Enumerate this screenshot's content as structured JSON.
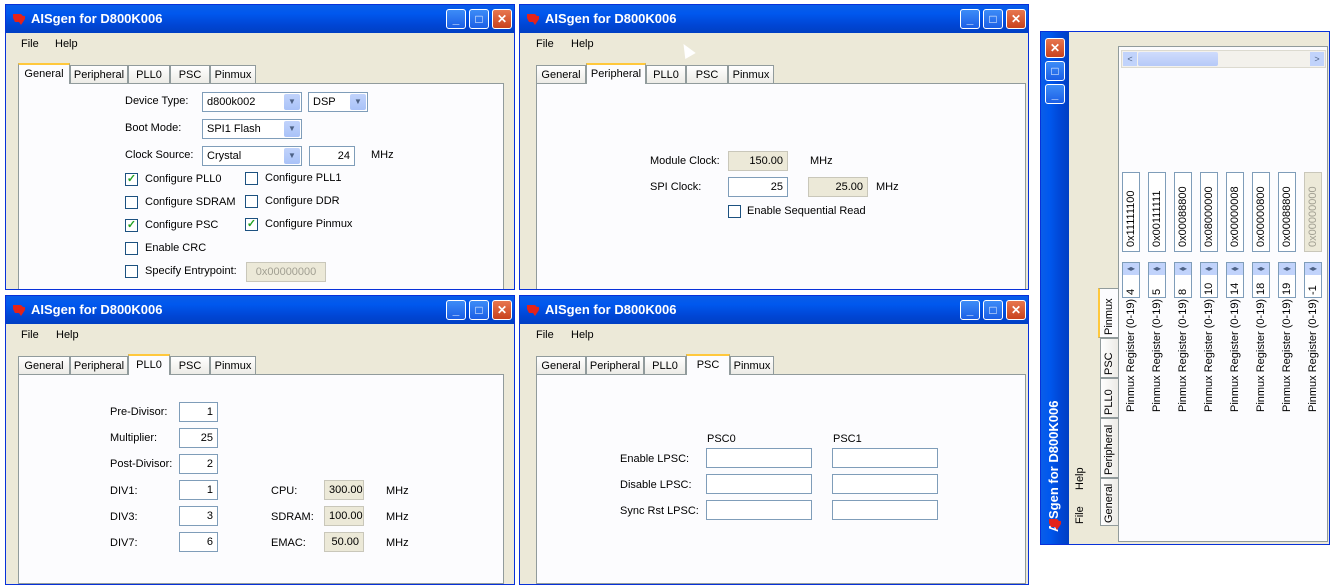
{
  "app_title": "AISgen for D800K006",
  "menu": {
    "file": "File",
    "help": "Help"
  },
  "tabs": [
    "General",
    "Peripheral",
    "PLL0",
    "PSC",
    "Pinmux"
  ],
  "general": {
    "device_type_label": "Device Type:",
    "device_type_value": "d800k002",
    "device_mode_value": "DSP",
    "boot_mode_label": "Boot Mode:",
    "boot_mode_value": "SPI1 Flash",
    "clock_source_label": "Clock Source:",
    "clock_source_value": "Crystal",
    "clock_freq_value": "24",
    "clock_unit": "MHz",
    "checkboxes": [
      {
        "label": "Configure PLL0",
        "checked": true
      },
      {
        "label": "Configure PLL1",
        "checked": false
      },
      {
        "label": "Configure SDRAM",
        "checked": false
      },
      {
        "label": "Configure DDR",
        "checked": false
      },
      {
        "label": "Configure PSC",
        "checked": true
      },
      {
        "label": "Configure Pinmux",
        "checked": true
      },
      {
        "label": "Enable CRC",
        "checked": false
      },
      {
        "label": "Specify Entrypoint:",
        "checked": false
      }
    ],
    "entrypoint_value": "0x00000000"
  },
  "peripheral": {
    "module_clock_label": "Module Clock:",
    "module_clock_value": "150.00",
    "module_clock_unit": "MHz",
    "spi_clock_label": "SPI Clock:",
    "spi_clock_input": "25",
    "spi_clock_actual": "25.00",
    "spi_clock_unit": "MHz",
    "seq_read_label": "Enable Sequential Read"
  },
  "pll0": {
    "pre_divisor_label": "Pre-Divisor:",
    "pre_divisor_value": "1",
    "multiplier_label": "Multiplier:",
    "multiplier_value": "25",
    "post_divisor_label": "Post-Divisor:",
    "post_divisor_value": "2",
    "div1_label": "DIV1:",
    "div1_value": "1",
    "div3_label": "DIV3:",
    "div3_value": "3",
    "div7_label": "DIV7:",
    "div7_value": "6",
    "cpu_label": "CPU:",
    "cpu_value": "300.00",
    "sdram_label": "SDRAM:",
    "sdram_value": "100.00",
    "emac_label": "EMAC:",
    "emac_value": "50.00",
    "unit": "MHz"
  },
  "psc": {
    "psc0_header": "PSC0",
    "psc1_header": "PSC1",
    "enable_label": "Enable LPSC:",
    "disable_label": "Disable LPSC:",
    "sync_rst_label": "Sync Rst LPSC:"
  },
  "pinmux": {
    "registers": [
      {
        "label": "Pinmux Register (0-19)",
        "index": "4",
        "value": "0x11111100",
        "disabled": false
      },
      {
        "label": "Pinmux Register (0-19)",
        "index": "5",
        "value": "0x00111111",
        "disabled": false
      },
      {
        "label": "Pinmux Register (0-19)",
        "index": "8",
        "value": "0x00088800",
        "disabled": false
      },
      {
        "label": "Pinmux Register (0-19)",
        "index": "10",
        "value": "0x08000000",
        "disabled": false
      },
      {
        "label": "Pinmux Register (0-19)",
        "index": "14",
        "value": "0x00000008",
        "disabled": false
      },
      {
        "label": "Pinmux Register (0-19)",
        "index": "18",
        "value": "0x00000800",
        "disabled": false
      },
      {
        "label": "Pinmux Register (0-19)",
        "index": "19",
        "value": "0x00088800",
        "disabled": false
      },
      {
        "label": "Pinmux Register (0-19)",
        "index": "-1",
        "value": "0x00000000",
        "disabled": true
      }
    ]
  },
  "colors": {
    "title_blue": "#0058ee",
    "window_face": "#ece9d8",
    "tab_accent": "#ffc83c",
    "close_red": "#c9421d"
  }
}
